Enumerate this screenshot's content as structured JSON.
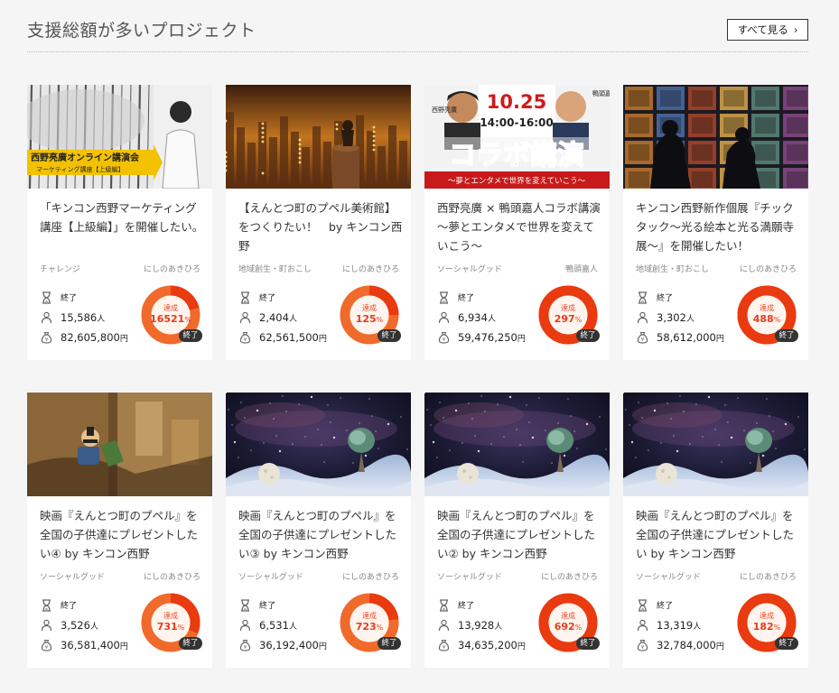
{
  "header": {
    "title": "支援総額が多いプロジェクト",
    "see_all": "すべて見る"
  },
  "labels": {
    "status": "終了",
    "achievement": "達成",
    "percent": "%",
    "people": "人",
    "yen": "円",
    "end_badge": "終了"
  },
  "cards": [
    {
      "title": "「キンコン西野マーケティング講座【上級編】」を開催したい。",
      "category": "チャレンジ",
      "owner": "にしのあきひろ",
      "status": "終了",
      "supporters": "15,586",
      "amount": "82,605,800",
      "percent": "16521",
      "thumb_text": [
        "西野亮廣オンライン講演会",
        "マーケティング講座【上級編】"
      ]
    },
    {
      "title": "【えんとつ町のプペル美術館】をつくりたい！　by キンコン西野",
      "category": "地域創生・町おこし",
      "owner": "にしのあきひろ",
      "status": "終了",
      "supporters": "2,404",
      "amount": "62,561,500",
      "percent": "125"
    },
    {
      "title": "西野亮廣 × 鴨頭嘉人コラボ講演　～夢とエンタメで世界を変えていこう～",
      "category": "ソーシャルグッド",
      "owner": "鴨頭嘉人",
      "status": "終了",
      "supporters": "6,934",
      "amount": "59,476,250",
      "percent": "297",
      "thumb_text": [
        "10.25",
        "14:00-16:00",
        "コラボ講演",
        "～夢とエンタメで世界を変えていこう～",
        "西野亮廣",
        "鴨頭嘉人"
      ]
    },
    {
      "title": "キンコン西野新作個展『チックタック～光る絵本と光る満願寺展～』を開催したい！",
      "category": "地域創生・町おこし",
      "owner": "にしのあきひろ",
      "status": "終了",
      "supporters": "3,302",
      "amount": "58,612,000",
      "percent": "488"
    },
    {
      "title": "映画『えんとつ町のプペル』を全国の子供達にプレゼントしたい④ by キンコン西野",
      "category": "ソーシャルグッド",
      "owner": "にしのあきひろ",
      "status": "終了",
      "supporters": "3,526",
      "amount": "36,581,400",
      "percent": "731"
    },
    {
      "title": "映画『えんとつ町のプペル』を全国の子供達にプレゼントしたい③ by キンコン西野",
      "category": "ソーシャルグッド",
      "owner": "にしのあきひろ",
      "status": "終了",
      "supporters": "6,531",
      "amount": "36,192,400",
      "percent": "723"
    },
    {
      "title": "映画『えんとつ町のプペル』を全国の子供達にプレゼントしたい② by キンコン西野",
      "category": "ソーシャルグッド",
      "owner": "にしのあきひろ",
      "status": "終了",
      "supporters": "13,928",
      "amount": "34,635,200",
      "percent": "692"
    },
    {
      "title": "映画『えんとつ町のプペル』を全国の子供達にプレゼントしたい by キンコン西野",
      "category": "ソーシャルグッド",
      "owner": "にしのあきひろ",
      "status": "終了",
      "supporters": "13,319",
      "amount": "32,784,000",
      "percent": "182"
    }
  ],
  "colors": {
    "ring_full": "#ea3a10",
    "ring_partial": "#f06a2c",
    "ring_track": "#fbd9c8"
  },
  "icons": {
    "status": "hourglass-icon",
    "supporters": "person-icon",
    "amount": "money-bag-icon",
    "see_all": "chevron-right-icon"
  }
}
